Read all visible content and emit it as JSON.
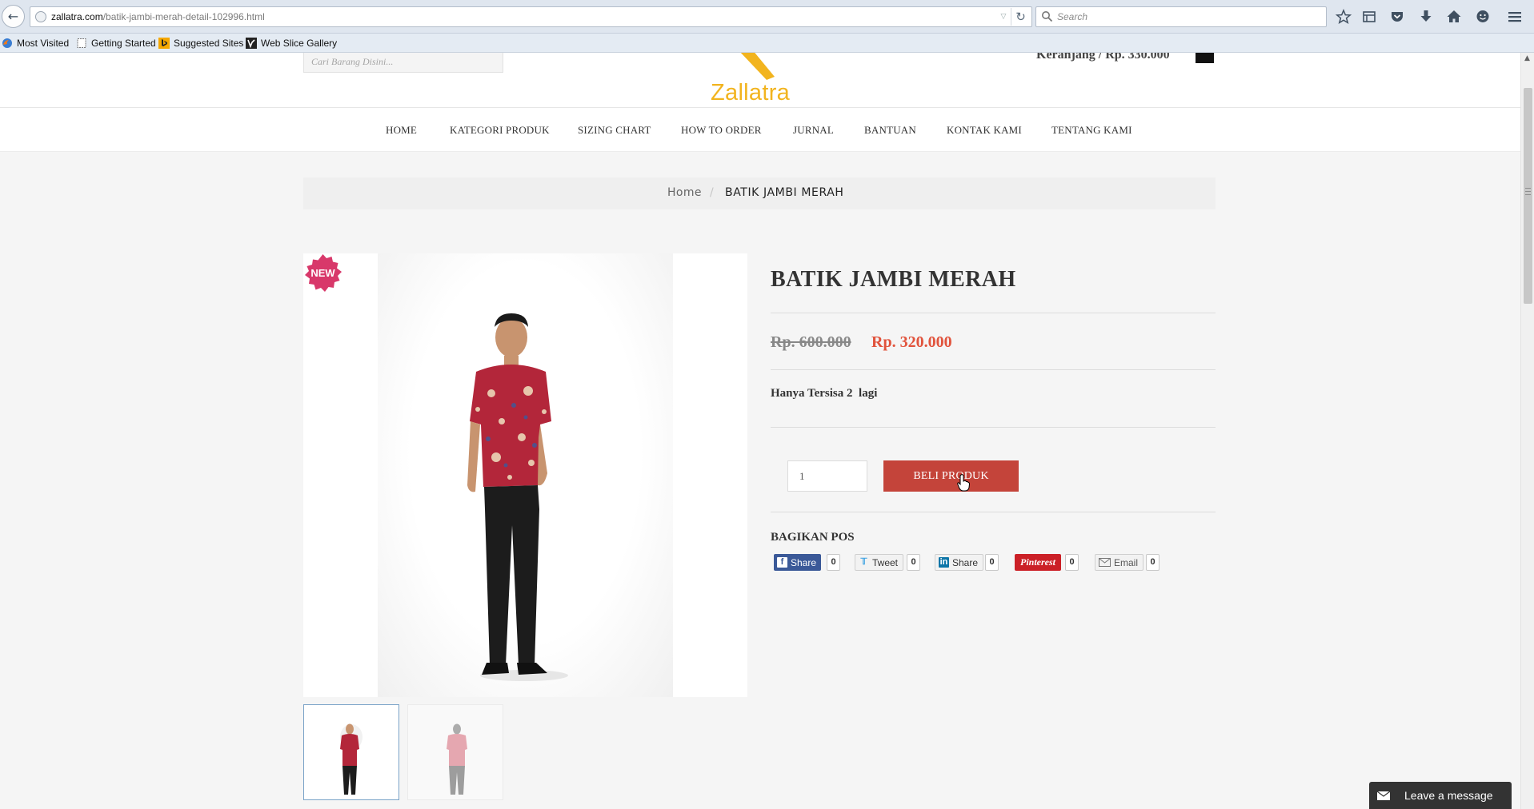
{
  "browser": {
    "url_domain": "zallatra.com",
    "url_path": "/batik-jambi-merah-detail-102996.html",
    "search_placeholder": "Search",
    "bookmarks": [
      {
        "label": "Most Visited",
        "icon": "firefox-icon"
      },
      {
        "label": "Getting Started",
        "icon": "page-icon"
      },
      {
        "label": "Suggested Sites",
        "icon": "bing-icon"
      },
      {
        "label": "Web Slice Gallery",
        "icon": "webslice-icon"
      }
    ]
  },
  "header": {
    "search_placeholder": "Cari Barang Disini...",
    "logo_text": "Zallatra",
    "cart_text": "Keranjang / Rp. 330.000"
  },
  "nav": {
    "items": [
      "HOME",
      "KATEGORI PRODUK",
      "SIZING CHART",
      "HOW TO ORDER",
      "JURNAL",
      "BANTUAN",
      "KONTAK KAMI",
      "TENTANG KAMI"
    ]
  },
  "breadcrumb": {
    "home": "Home",
    "separator": "/",
    "current": "BATIK JAMBI MERAH"
  },
  "product": {
    "badge": "NEW",
    "title": "BATIK JAMBI MERAH",
    "price_old": "Rp. 600.000",
    "price_new": "Rp. 320.000",
    "stock_text": "Hanya Tersisa 2  lagi",
    "quantity": "1",
    "buy_label": "BELI PRODUK",
    "thumbnails": 2
  },
  "share": {
    "title": "BAGIKAN POS",
    "buttons": [
      {
        "label": "Share",
        "network": "facebook",
        "count": "0"
      },
      {
        "label": "Tweet",
        "network": "twitter",
        "count": "0"
      },
      {
        "label": "Share",
        "network": "linkedin",
        "count": "0"
      },
      {
        "label": "Pinterest",
        "network": "pinterest",
        "count": "0"
      },
      {
        "label": "Email",
        "network": "email",
        "count": "0"
      }
    ]
  },
  "chat": {
    "label": "Leave a message"
  },
  "colors": {
    "accent_red": "#c4443a",
    "price_red": "#e1533c",
    "logo_yellow": "#f2b41f",
    "facebook": "#3b5998",
    "pinterest": "#cb2027"
  }
}
